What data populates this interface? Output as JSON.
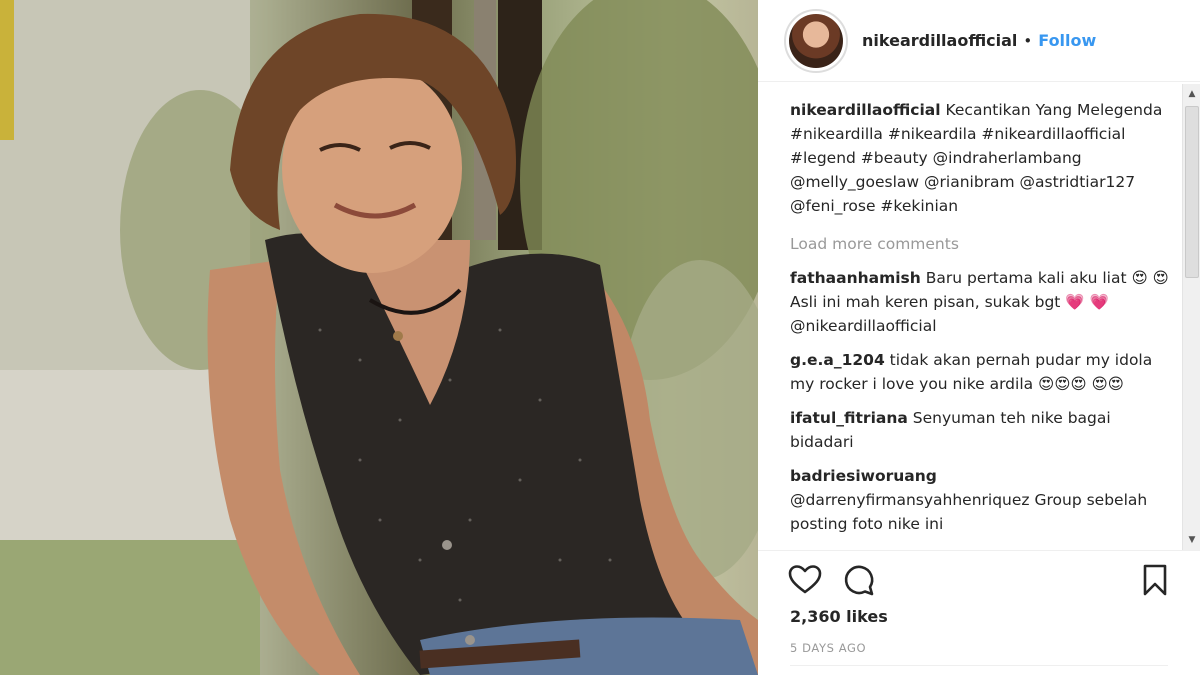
{
  "post": {
    "username": "nikeardillaofficial",
    "separator": "•",
    "follow_label": "Follow",
    "caption_user": "nikeardillaofficial",
    "caption_text": "Kecantikan Yang Melegenda #nikeardilla #nikeardila #nikeardillaofficial #legend #beauty @indraherlambang @melly_goeslaw @rianibram @astridtiar127 @feni_rose #kekinian",
    "load_more_label": "Load more comments",
    "comments": [
      {
        "user": "fathaanhamish",
        "text": "Baru pertama kali aku liat 😍 😍 Asli ini mah keren pisan, sukak bgt 💗 💗@nikeardillaofficial"
      },
      {
        "user": "g.e.a_1204",
        "text": "tidak akan pernah pudar my idola my rocker i love you nike ardila 😍😍😍 😍😍"
      },
      {
        "user": "ifatul_fitriana",
        "text": "Senyuman teh nike bagai bidadari"
      },
      {
        "user": "badriesiworuang",
        "text": "@darrenyfirmansyahhenriquez Group sebelah posting foto nike ini"
      }
    ],
    "likes_text": "2,360 likes",
    "time_text": "5 DAYS AGO"
  },
  "icons": {
    "like": "heart-icon",
    "comment": "comment-bubble-icon",
    "save": "bookmark-icon",
    "scroll_up": "scroll-up-arrow-icon",
    "scroll_down": "scroll-down-arrow-icon"
  },
  "colors": {
    "follow": "#3897f0",
    "muted": "#999999",
    "text": "#262626"
  }
}
